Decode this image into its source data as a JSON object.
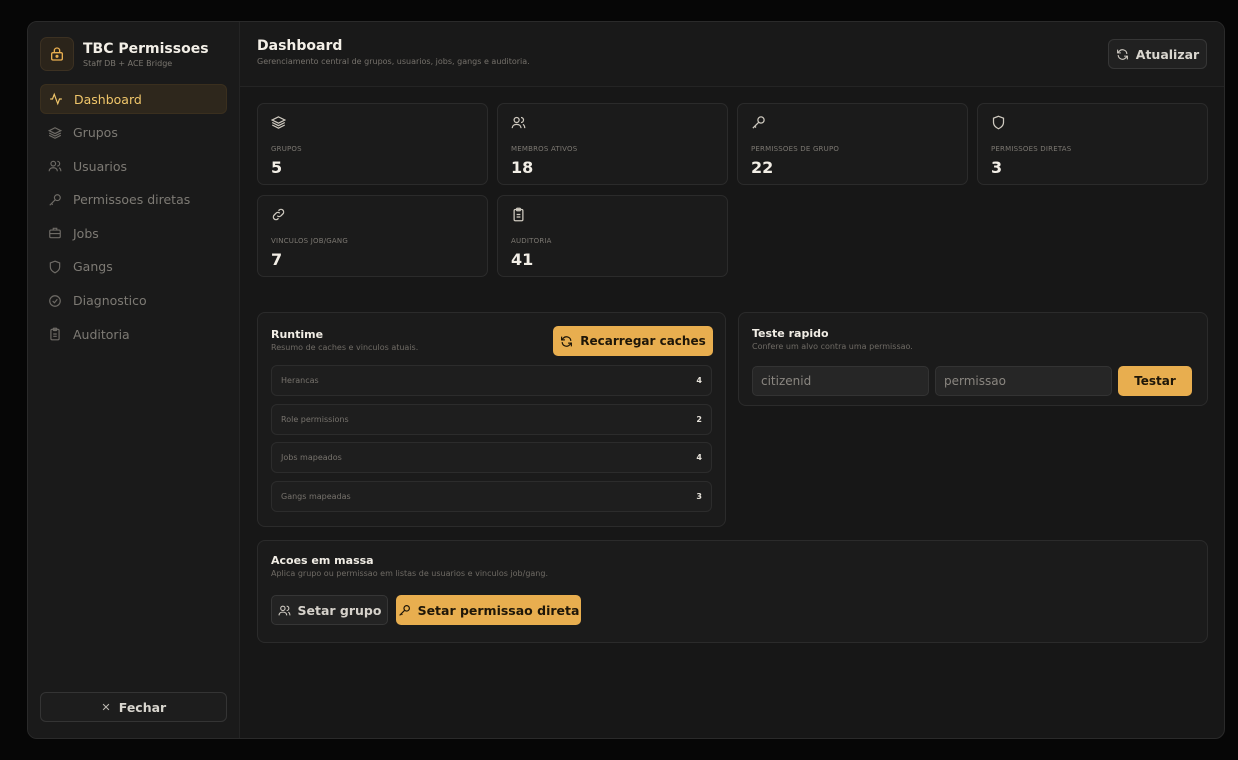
{
  "brand": {
    "title": "TBC Permissoes",
    "subtitle": "Staff DB + ACE Bridge",
    "logo_icon": "lock-icon"
  },
  "sidebar": {
    "items": [
      {
        "label": "Dashboard",
        "icon": "activity-icon",
        "active": true
      },
      {
        "label": "Grupos",
        "icon": "layers-icon"
      },
      {
        "label": "Usuarios",
        "icon": "users-icon"
      },
      {
        "label": "Permissoes diretas",
        "icon": "key-icon"
      },
      {
        "label": "Jobs",
        "icon": "briefcase-icon"
      },
      {
        "label": "Gangs",
        "icon": "shield-icon"
      },
      {
        "label": "Diagnostico",
        "icon": "check-circle-icon"
      },
      {
        "label": "Auditoria",
        "icon": "clipboard-icon"
      }
    ],
    "close_label": "Fechar"
  },
  "header": {
    "title": "Dashboard",
    "subtitle": "Gerenciamento central de grupos, usuarios, jobs, gangs e auditoria.",
    "refresh_label": "Atualizar"
  },
  "stats": [
    {
      "label": "GRUPOS",
      "value": "5",
      "icon": "layers-icon"
    },
    {
      "label": "MEMBROS ATIVOS",
      "value": "18",
      "icon": "users-icon"
    },
    {
      "label": "PERMISSOES DE GRUPO",
      "value": "22",
      "icon": "key-icon"
    },
    {
      "label": "PERMISSOES DIRETAS",
      "value": "3",
      "icon": "shield-icon"
    },
    {
      "label": "VINCULOS JOB/GANG",
      "value": "7",
      "icon": "link-icon"
    },
    {
      "label": "AUDITORIA",
      "value": "41",
      "icon": "clipboard-icon"
    }
  ],
  "runtime": {
    "title": "Runtime",
    "subtitle": "Resumo de caches e vinculos atuais.",
    "reload_label": "Recarregar caches",
    "rows": [
      {
        "name": "Herancas",
        "value": "4"
      },
      {
        "name": "Role permissions",
        "value": "2"
      },
      {
        "name": "Jobs mapeados",
        "value": "4"
      },
      {
        "name": "Gangs mapeadas",
        "value": "3"
      }
    ]
  },
  "quick_test": {
    "title": "Teste rapido",
    "subtitle": "Confere um alvo contra uma permissao.",
    "citizenid_placeholder": "citizenid",
    "permission_placeholder": "permissao",
    "test_label": "Testar"
  },
  "mass": {
    "title": "Acoes em massa",
    "subtitle": "Aplica grupo ou permissao em listas de usuarios e vinculos job/gang.",
    "set_group_label": "Setar grupo",
    "set_direct_label": "Setar permissao direta"
  },
  "colors": {
    "accent": "#e8ae4f",
    "background": "#171717",
    "active_nav": "#2e271c"
  }
}
